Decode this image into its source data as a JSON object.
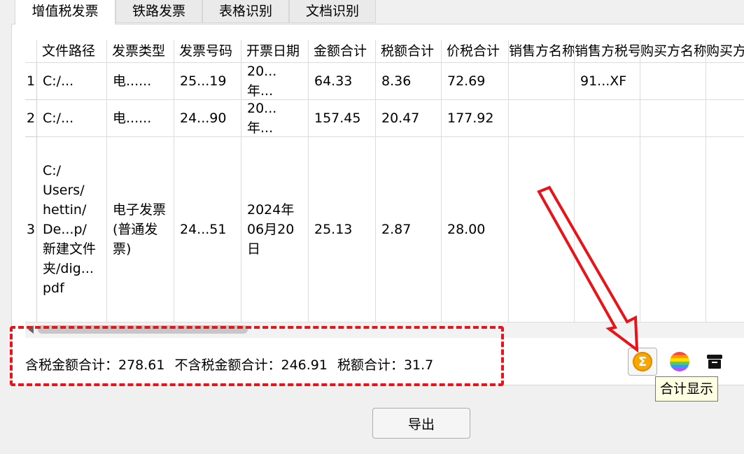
{
  "tabs": [
    {
      "label": "增值税发票",
      "active": true
    },
    {
      "label": "铁路发票",
      "active": false
    },
    {
      "label": "表格识别",
      "active": false
    },
    {
      "label": "文档识别",
      "active": false
    }
  ],
  "table": {
    "columns": [
      "文件路径",
      "发票类型",
      "发票号码",
      "开票日期",
      "金额合计",
      "税额合计",
      "价税合计",
      "销售方名称",
      "销售方税号",
      "购买方名称",
      "购买方税号"
    ],
    "rows": [
      {
        "num": "1",
        "cells": [
          "C:/...",
          "电......",
          "25...19",
          "20...年...",
          "64.33",
          "8.36",
          "72.69",
          "",
          "91...XF",
          "",
          ""
        ]
      },
      {
        "num": "2",
        "cells": [
          "C:/...",
          "电......",
          "24...90",
          "20...年...",
          "157.45",
          "20.47",
          "177.92",
          "",
          "",
          "",
          ""
        ]
      },
      {
        "num": "3",
        "cells": [
          "C:/\nUsers/\nhettin/\nDe...p/\n新建文件\n夹/dig...\npdf",
          "电子发票\n(普通发\n票)",
          "24...51",
          "2024年\n06月20\n日",
          "25.13",
          "2.87",
          "28.00",
          "",
          "",
          "",
          ""
        ]
      }
    ]
  },
  "summary": {
    "with_tax": "含税金额合计：278.61",
    "without_tax": "不含税金额合计：246.91",
    "tax": "税额合计：31.7"
  },
  "toolbar": {
    "sum_icon": "sigma-icon",
    "color_icon": "rainbow-icon",
    "archive_icon": "archive-icon",
    "tooltip": "合计显示"
  },
  "export_label": "导出",
  "annotation_color": "#e8141a"
}
